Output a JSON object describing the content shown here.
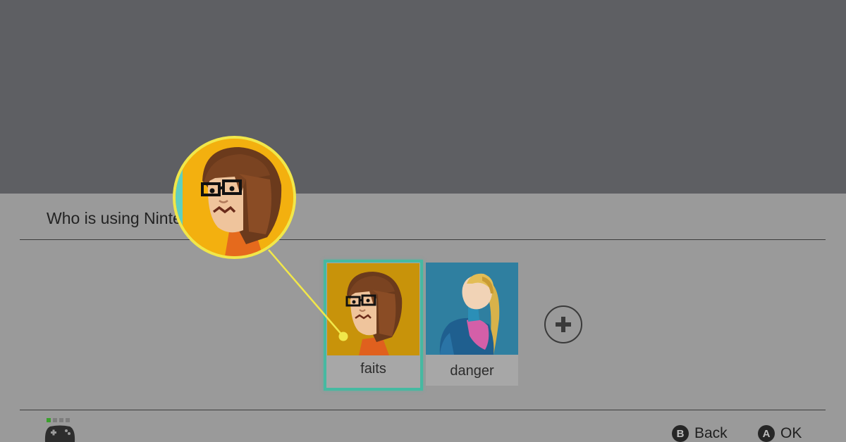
{
  "prompt": {
    "text": "Who is using Nintendo Switch?"
  },
  "users": [
    {
      "name": "faits",
      "selected": true
    },
    {
      "name": "danger",
      "selected": false
    }
  ],
  "add_user": {
    "icon": "plus-icon"
  },
  "footer": {
    "back": {
      "glyph": "B",
      "label": "Back"
    },
    "ok": {
      "glyph": "A",
      "label": "OK"
    }
  },
  "colors": {
    "selection": "#46b9a1",
    "callout": "#f1e74a",
    "mii_background": "#f3b00f"
  }
}
